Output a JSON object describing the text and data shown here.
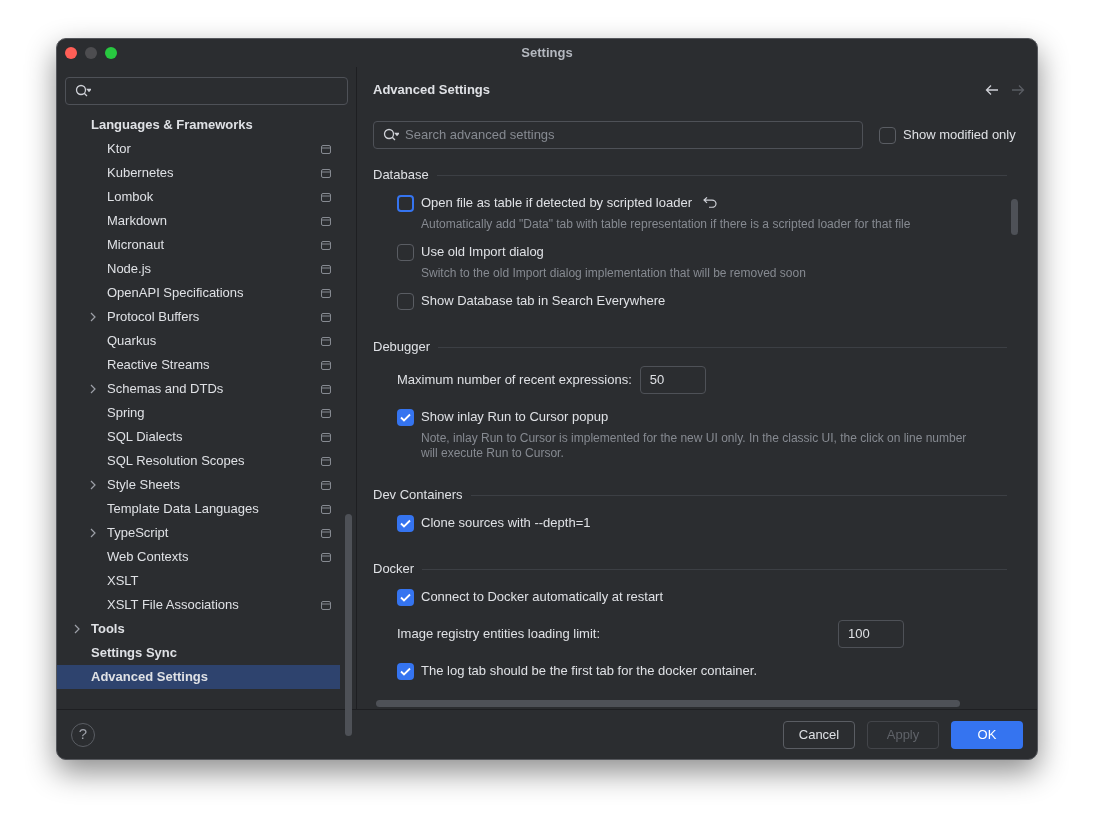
{
  "window": {
    "title": "Settings"
  },
  "sidebar": {
    "tree": [
      {
        "label": "Languages & Frameworks",
        "expandable": false,
        "selected": false,
        "children": [
          {
            "label": "Ktor",
            "expandable": false,
            "project_level": true,
            "selected": false
          },
          {
            "label": "Kubernetes",
            "expandable": false,
            "project_level": true,
            "selected": false
          },
          {
            "label": "Lombok",
            "expandable": false,
            "project_level": true,
            "selected": false
          },
          {
            "label": "Markdown",
            "expandable": false,
            "project_level": true,
            "selected": false
          },
          {
            "label": "Micronaut",
            "expandable": false,
            "project_level": true,
            "selected": false
          },
          {
            "label": "Node.js",
            "expandable": false,
            "project_level": true,
            "selected": false
          },
          {
            "label": "OpenAPI Specifications",
            "expandable": false,
            "project_level": true,
            "selected": false
          },
          {
            "label": "Protocol Buffers",
            "expandable": true,
            "project_level": true,
            "selected": false
          },
          {
            "label": "Quarkus",
            "expandable": false,
            "project_level": true,
            "selected": false
          },
          {
            "label": "Reactive Streams",
            "expandable": false,
            "project_level": true,
            "selected": false
          },
          {
            "label": "Schemas and DTDs",
            "expandable": true,
            "project_level": true,
            "selected": false
          },
          {
            "label": "Spring",
            "expandable": false,
            "project_level": true,
            "selected": false
          },
          {
            "label": "SQL Dialects",
            "expandable": false,
            "project_level": true,
            "selected": false
          },
          {
            "label": "SQL Resolution Scopes",
            "expandable": false,
            "project_level": true,
            "selected": false
          },
          {
            "label": "Style Sheets",
            "expandable": true,
            "project_level": true,
            "selected": false
          },
          {
            "label": "Template Data Languages",
            "expandable": false,
            "project_level": true,
            "selected": false
          },
          {
            "label": "TypeScript",
            "expandable": true,
            "project_level": true,
            "selected": false
          },
          {
            "label": "Web Contexts",
            "expandable": false,
            "project_level": true,
            "selected": false
          },
          {
            "label": "XSLT",
            "expandable": false,
            "project_level": false,
            "selected": false
          },
          {
            "label": "XSLT File Associations",
            "expandable": false,
            "project_level": true,
            "selected": false
          }
        ]
      },
      {
        "label": "Tools",
        "expandable": true,
        "selected": false
      },
      {
        "label": "Settings Sync",
        "expandable": false,
        "selected": false
      },
      {
        "label": "Advanced Settings",
        "expandable": false,
        "selected": true
      }
    ]
  },
  "panel": {
    "title": "Advanced Settings",
    "search": {
      "placeholder": "Search advanced settings"
    },
    "show_modified_only": {
      "label": "Show modified only",
      "checked": false
    },
    "sections": [
      {
        "title": "Database",
        "items": [
          {
            "kind": "checkbox",
            "label": "Open file as table if detected by scripted loader",
            "checked": false,
            "focused": true,
            "modified": true,
            "description": "Automatically add \"Data\" tab with table representation if there is a scripted loader for that file"
          },
          {
            "kind": "checkbox",
            "label": "Use old Import dialog",
            "checked": false,
            "focused": false,
            "modified": false,
            "description": "Switch to the old Import dialog implementation that will be removed soon"
          },
          {
            "kind": "checkbox",
            "label": "Show Database tab in Search Everywhere",
            "checked": false,
            "focused": false,
            "modified": false
          }
        ]
      },
      {
        "title": "Debugger",
        "items": [
          {
            "kind": "inline",
            "label": "Maximum number of recent expressions:",
            "value": "50"
          },
          {
            "kind": "checkbox",
            "label": "Show inlay Run to Cursor popup",
            "checked": true,
            "focused": false,
            "modified": false,
            "description": "Note, inlay Run to Cursor is implemented for the new UI only. In the classic UI, the click on line number will execute Run to Cursor."
          }
        ]
      },
      {
        "title": "Dev Containers",
        "items": [
          {
            "kind": "checkbox",
            "label": "Clone sources with --depth=1",
            "checked": true,
            "focused": false,
            "modified": false
          }
        ]
      },
      {
        "title": "Docker",
        "items": [
          {
            "kind": "checkbox",
            "label": "Connect to Docker automatically at restart",
            "checked": true,
            "focused": false,
            "modified": false
          },
          {
            "kind": "aligned",
            "label": "Image registry entities loading limit:",
            "value": "100"
          },
          {
            "kind": "checkbox",
            "label": "The log tab should be the first tab for the docker container.",
            "checked": true,
            "focused": false,
            "modified": false
          }
        ]
      }
    ]
  },
  "footer": {
    "help": "?",
    "buttons": [
      {
        "label": "Cancel",
        "kind": "secondary",
        "disabled": false
      },
      {
        "label": "Apply",
        "kind": "secondary",
        "disabled": true
      },
      {
        "label": "OK",
        "kind": "primary",
        "disabled": false
      }
    ]
  }
}
